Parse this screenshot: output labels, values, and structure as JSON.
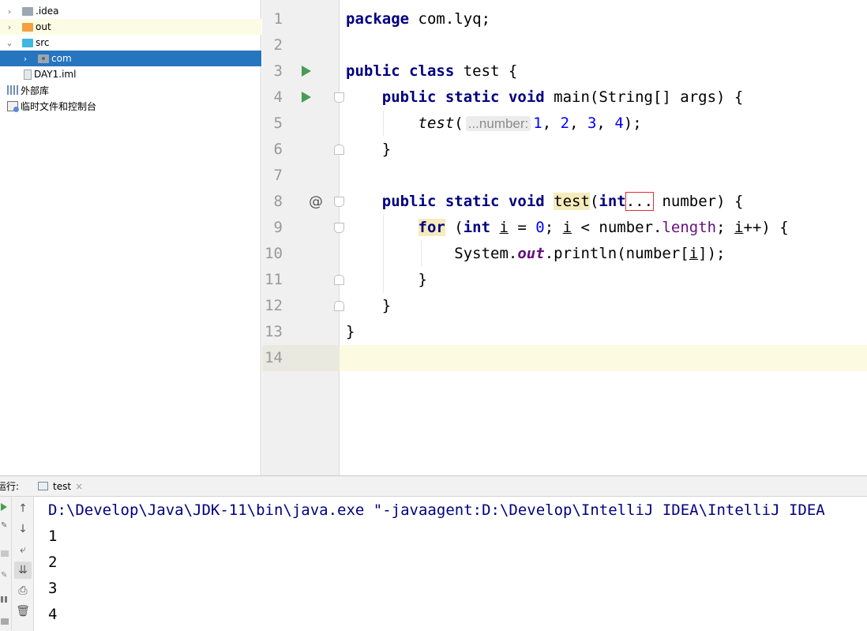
{
  "tree": {
    "items": [
      {
        "label": ".idea",
        "icon": "folder-icon"
      },
      {
        "label": "out",
        "icon": "folder-icon"
      },
      {
        "label": "src",
        "icon": "source-folder-icon"
      },
      {
        "label": "com",
        "icon": "package-icon"
      },
      {
        "label": "DAY1.iml",
        "icon": "module-file-icon"
      },
      {
        "label": "外部库",
        "icon": "library-icon"
      },
      {
        "label": "临时文件和控制台",
        "icon": "scratch-icon"
      }
    ]
  },
  "editor": {
    "line_numbers": [
      "1",
      "2",
      "3",
      "4",
      "5",
      "6",
      "7",
      "8",
      "9",
      "10",
      "11",
      "12",
      "13",
      "14"
    ],
    "code": {
      "l1_kw": "package",
      "l1_rest": " com.lyq;",
      "l3_kw1": "public",
      "l3_kw2": "class",
      "l3_rest": " test {",
      "l4_kw1": "public",
      "l4_kw2": "static",
      "l4_kw3": "void",
      "l4_rest": " main(String[] args) {",
      "l5_call": "test",
      "l5_paren": "(",
      "l5_hint": "...number:",
      "l5_n1": "1",
      "l5_c1": ", ",
      "l5_n2": "2",
      "l5_c2": ", ",
      "l5_n3": "3",
      "l5_c3": ", ",
      "l5_n4": "4",
      "l5_end": ");",
      "l6": "}",
      "l8_kw1": "public",
      "l8_kw2": "static",
      "l8_kw3": "void",
      "l8_name": "test",
      "l8_paren": "(",
      "l8_int": "int",
      "l8_dots": "...",
      "l8_rest": " number) {",
      "l9_for": "for",
      "l9_p1": " (",
      "l9_int": "int",
      "l9_sp": " ",
      "l9_i1": "i",
      "l9_eq": " = ",
      "l9_zero": "0",
      "l9_semi": "; ",
      "l9_i2": "i",
      "l9_lt": " < number.",
      "l9_len": "length",
      "l9_semi2": "; ",
      "l9_i3": "i",
      "l9_end": "++) {",
      "l10_sys": "System.",
      "l10_out": "out",
      "l10_mid": ".println(number[",
      "l10_i": "i",
      "l10_end": "]);",
      "l11": "}",
      "l12": "}",
      "l13": "}"
    }
  },
  "run": {
    "label": "运行:",
    "tab": "test",
    "tab_close": "×",
    "console": [
      "D:\\Develop\\Java\\JDK-11\\bin\\java.exe \"-javaagent:D:\\Develop\\IntelliJ IDEA\\IntelliJ IDEA",
      "1",
      "2",
      "3",
      "4"
    ]
  },
  "colors": {
    "keyword": "#000080",
    "number": "#0000ff",
    "field": "#660e7a",
    "selection": "#2675bf",
    "current_line": "#fcfae1",
    "run_icon": "#499c54"
  }
}
